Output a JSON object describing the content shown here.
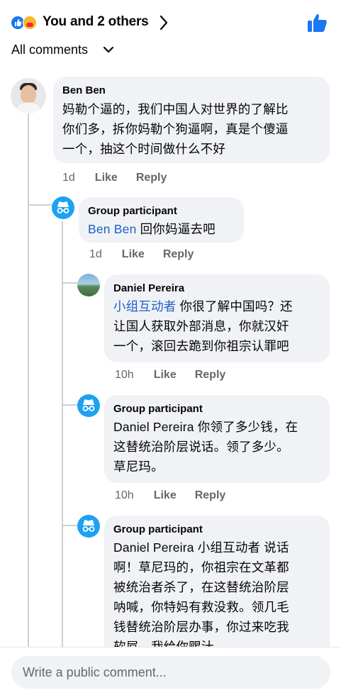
{
  "header": {
    "title": "You and 2 others",
    "filter_label": "All comments"
  },
  "colors": {
    "like_blue": "#1877f2",
    "mention_blue": "#1d61c9",
    "bubble_bg": "#f0f2f5",
    "meta_gray": "#65676b"
  },
  "comments": [
    {
      "author": "Ben Ben",
      "text": "妈勒个逼的，我们中国人对世界的了解比\n你们多，拆你妈勒个狗逼啊，真是个傻逼\n一个，抽这个时间做什么不好",
      "time": "1d",
      "like": "Like",
      "reply": "Reply"
    },
    {
      "author": "Group participant",
      "mention": "Ben Ben",
      "text": " 回你妈逼去吧",
      "time": "1d",
      "like": "Like",
      "reply": "Reply"
    },
    {
      "author": "Daniel Pereira",
      "mention": "小组互动者",
      "text_line1": " 你很了解中国吗？还",
      "text_rest": "让国人获取外部消息，你就汉奸\n一个，滚回去跪到你祖宗认罪吧",
      "time": "10h",
      "like": "Like",
      "reply": "Reply"
    },
    {
      "author": "Group participant",
      "text": "Daniel Pereira 你领了多少钱，在\n这替统治阶层说话。领了多少。\n草尼玛。",
      "time": "10h",
      "like": "Like",
      "reply": "Reply"
    },
    {
      "author": "Group participant",
      "text": "Daniel Pereira 小组互动者 说话\n啊！草尼玛的，你祖宗在文革都\n被统治者杀了，在这替统治阶层\n呐喊，你特妈有救没救。领几毛\n钱替统治阶层办事，你过来吃我\n软屌，我给你赐汁"
    }
  ],
  "compose": {
    "placeholder": "Write a public comment..."
  }
}
